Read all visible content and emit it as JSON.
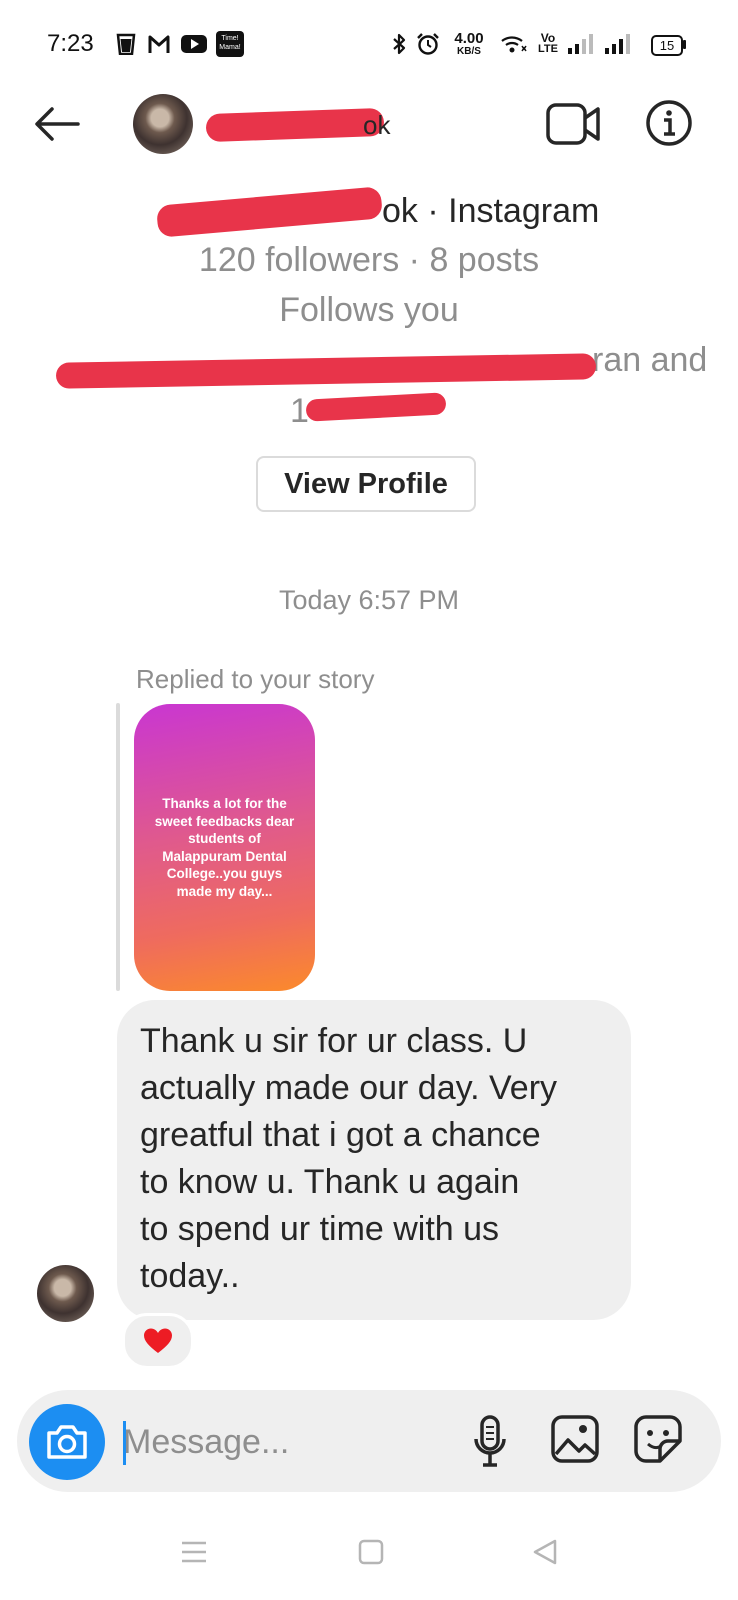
{
  "status_bar": {
    "time": "7:23",
    "network_speed_value": "4.00",
    "network_speed_unit": "KB/S",
    "volte_top": "Vo",
    "volte_bottom": "LTE",
    "battery": "15",
    "timer_label_1": "Time!",
    "timer_label_2": "Mama!",
    "icons": [
      "glass-icon",
      "gmail-icon",
      "youtube-icon",
      "timer-app-icon",
      "bluetooth-icon",
      "alarm-icon",
      "wifi-icon",
      "signal-icon",
      "battery-icon"
    ]
  },
  "header": {
    "username_suffix": "ok",
    "icons": [
      "back-arrow-icon",
      "video-call-icon",
      "info-icon"
    ]
  },
  "profile": {
    "name_suffix": "ok · Instagram",
    "stats": "120 followers · 8 posts",
    "follows_you": "Follows you",
    "mutual_line1_suffix": "ran and",
    "mutual_line2_prefix": "1",
    "view_profile_label": "View Profile"
  },
  "conversation": {
    "timestamp": "Today 6:57 PM",
    "story_reply_label": "Replied to your story",
    "story_text": "Thanks a lot for the sweet feedbacks dear students of Malappuram Dental College..you guys made my day...",
    "message_text": "Thank u sir for ur class. U\nactually made our day. Very\ngreatful that i got a chance\nto  know u. Thank u again\nto spend ur time with us\ntoday..",
    "reaction": "heart"
  },
  "composer": {
    "placeholder": "Message...",
    "icons": [
      "camera-icon",
      "microphone-icon",
      "gallery-icon",
      "sticker-icon"
    ]
  },
  "nav_bar": {
    "icons": [
      "menu-icon",
      "home-icon",
      "back-icon"
    ]
  },
  "colors": {
    "accent_blue": "#1c8ef2",
    "redaction": "#e8344a",
    "bubble_bg": "#efefef",
    "secondary_text": "#8e8e8e",
    "heart": "#ed1c24"
  }
}
